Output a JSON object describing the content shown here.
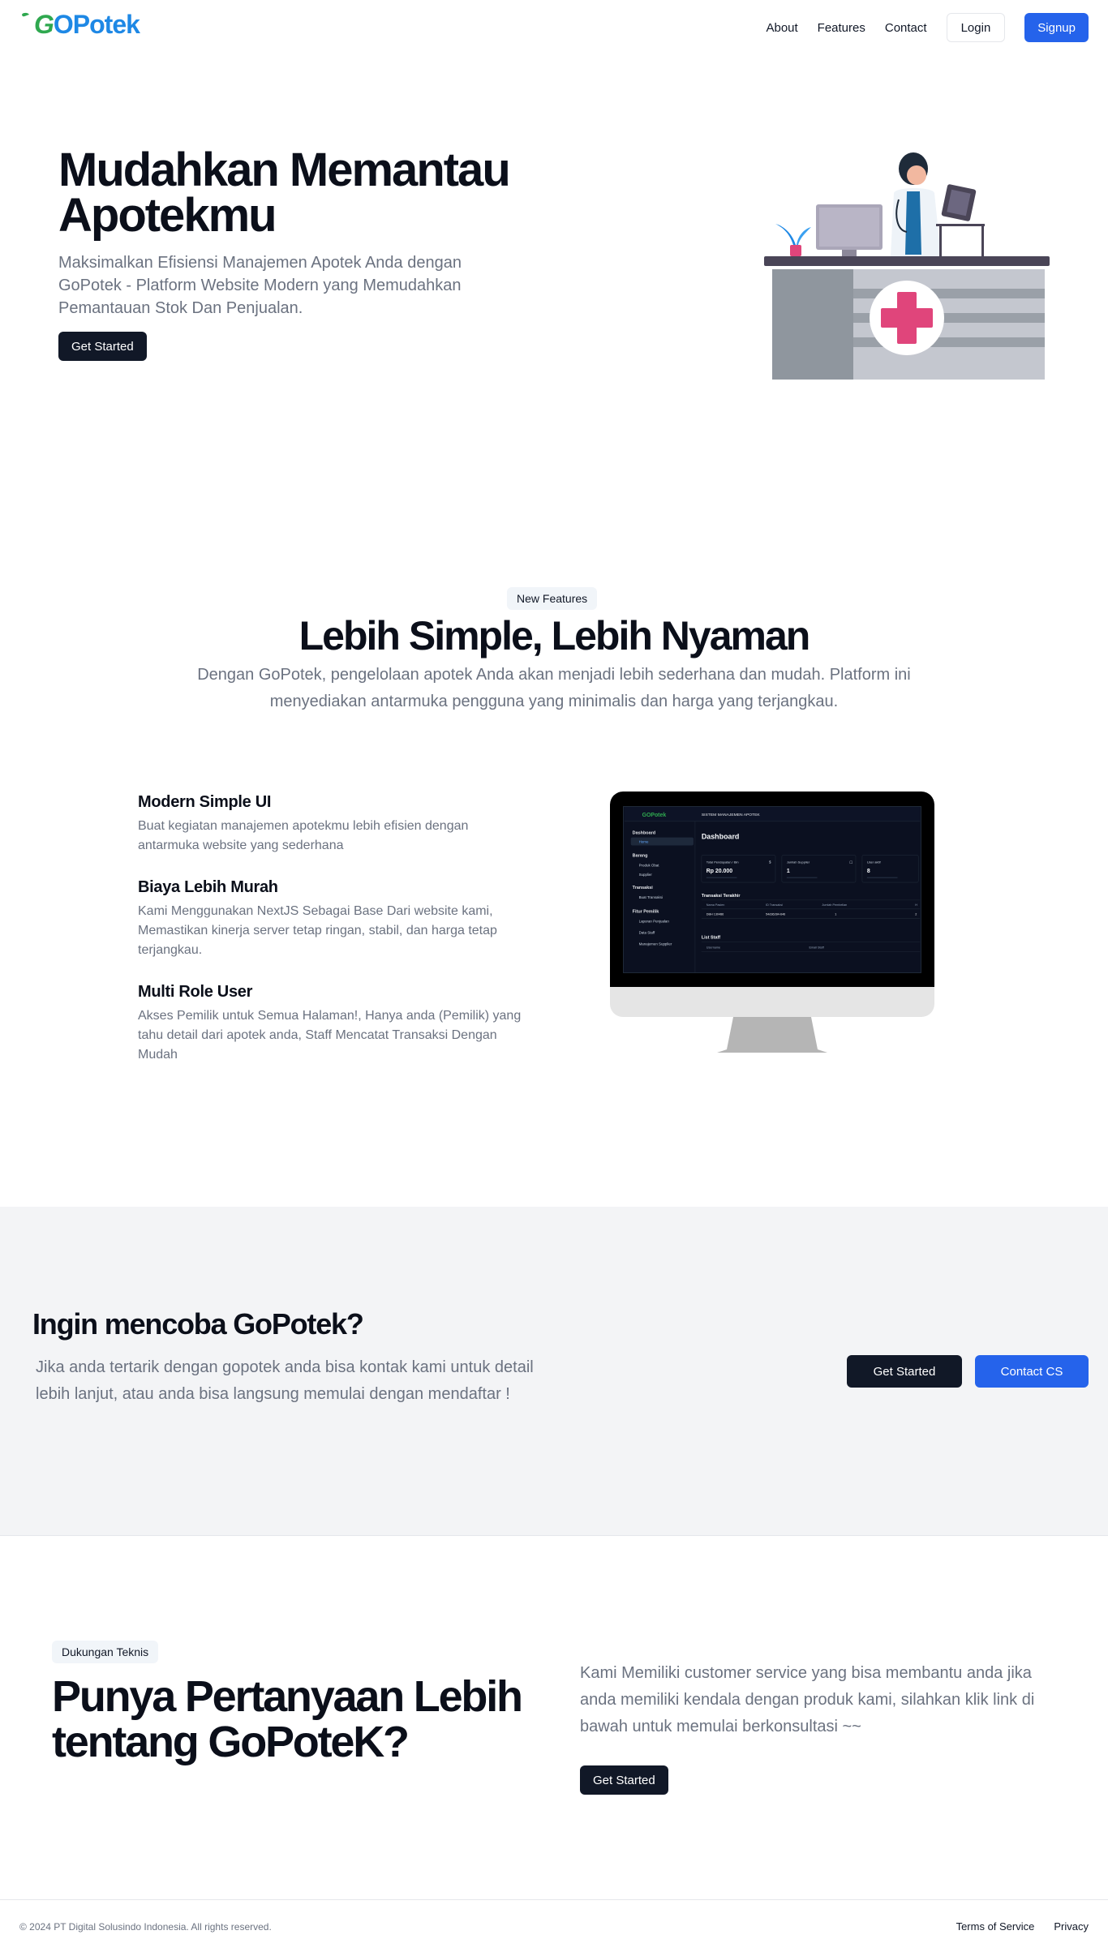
{
  "brand": {
    "logo_g": "G",
    "logo_rest": "OPotek"
  },
  "nav": {
    "links": [
      "About",
      "Features",
      "Contact"
    ],
    "login": "Login",
    "signup": "Signup"
  },
  "hero": {
    "title_line1": "Mudahkan Memantau",
    "title_line2": "Apotekmu",
    "subtitle": "Maksimalkan Efisiensi Manajemen Apotek Anda dengan GoPotek - Platform Website Modern yang Memudahkan Pemantauan Stok Dan Penjualan.",
    "cta": "Get Started"
  },
  "features": {
    "badge": "New Features",
    "title": "Lebih Simple, Lebih Nyaman",
    "subtitle": "Dengan GoPotek, pengelolaan apotek Anda akan menjadi lebih sederhana dan mudah. Platform ini menyediakan antarmuka pengguna yang minimalis dan harga yang terjangkau.",
    "items": [
      {
        "title": "Modern Simple UI",
        "text": "Buat kegiatan manajemen apotekmu lebih efisien dengan antarmuka website yang sederhana"
      },
      {
        "title": "Biaya Lebih Murah",
        "text": "Kami Menggunakan NextJS Sebagai Base Dari website kami, Memastikan kinerja server tetap ringan, stabil, dan harga tetap terjangkau."
      },
      {
        "title": "Multi Role User",
        "text": "Akses Pemilik untuk Semua Halaman!, Hanya anda (Pemilik) yang tahu detail dari apotek anda, Staff Mencatat Transaksi Dengan Mudah"
      }
    ],
    "screen": {
      "logo": "GOPotek",
      "header": "SISTEM MANAJEMEN APOTEK",
      "page_title": "Dashboard",
      "sidebar": {
        "dashboard": "Dashboard",
        "home": "Home",
        "barang": "Barang",
        "produk_obat": "Produk Obat",
        "supplier": "Supplier",
        "transaksi": "Transaksi",
        "buat_transaksi": "Buat Transaksi",
        "fitur_pemilik": "Fitur Pemilik",
        "laporan": "Laporan Penjualan",
        "data_staff": "Data Staff",
        "manajemen_supplier": "Manajemen Supplier"
      },
      "cards": [
        {
          "label": "Total Pendapatan / Bln",
          "icon": "$",
          "value": "Rp 20.000"
        },
        {
          "label": "Jumlah Supplier",
          "icon": "▢",
          "value": "1"
        },
        {
          "label": "User aktif",
          "icon": "",
          "value": "8"
        }
      ],
      "tx_title": "Transaksi Terakhir",
      "tx_headers": [
        "Nama Pasien",
        "ID Transaksi",
        "Jumlah Pembelian",
        "H"
      ],
      "tx_row": [
        "DBH 130486",
        "54d36284-646",
        "1",
        "2"
      ],
      "staff_title": "List Staff",
      "staff_headers": [
        "Username",
        "Email Staff"
      ]
    }
  },
  "cta": {
    "title": "Ingin mencoba GoPotek?",
    "subtitle": "Jika anda tertarik dengan gopotek anda bisa kontak kami untuk detail lebih lanjut, atau anda bisa langsung memulai dengan mendaftar !",
    "primary": "Get Started",
    "secondary": "Contact CS"
  },
  "support": {
    "badge": "Dukungan Teknis",
    "title": "Punya Pertanyaan Lebih tentang GoPoteK?",
    "text": "Kami Memiliki customer service yang bisa membantu anda jika anda memiliki kendala dengan produk kami, silahkan klik link di bawah untuk memulai berkonsultasi ~~",
    "cta": "Get Started"
  },
  "footer": {
    "copyright": "© 2024 PT Digital Solusindo Indonesia. All rights reserved.",
    "terms": "Terms of Service",
    "privacy": "Privacy"
  },
  "colors": {
    "primary_blue": "#2563eb",
    "dark": "#111827",
    "logo_green": "#2fa84f",
    "logo_blue": "#1e88e5",
    "muted": "#6b7280",
    "cta_bg": "#f3f4f6"
  },
  "icons": [
    "leaf-logo-icon",
    "pharmacist-illustration",
    "monitor-illustration"
  ]
}
